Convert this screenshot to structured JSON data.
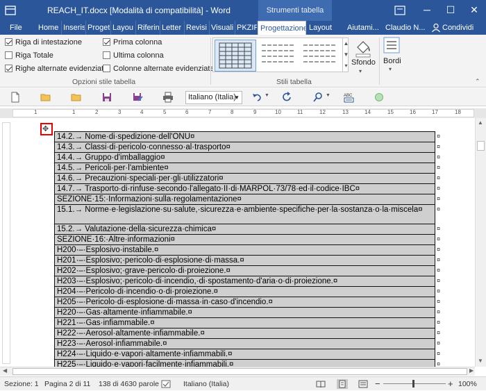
{
  "titlebar": {
    "doc_title": "REACH_IT.docx [Modalità di compatibilità]  -  Word",
    "context_tab": "Strumenti tabella",
    "minimize": "─",
    "maximize": "☐",
    "close": "✕",
    "restore_icon": "ribbon-display-icon"
  },
  "tabs": [
    {
      "label": "File"
    },
    {
      "label": "Home"
    },
    {
      "label": "Inseris"
    },
    {
      "label": "Proget"
    },
    {
      "label": "Layou"
    },
    {
      "label": "Riferin"
    },
    {
      "label": "Letter"
    },
    {
      "label": "Revisi"
    },
    {
      "label": "Visuali"
    },
    {
      "label": "PKZIP"
    },
    {
      "label": "Progettazione"
    },
    {
      "label": "Layout"
    },
    {
      "label": "Aiutami..."
    },
    {
      "label": "Claudio N..."
    },
    {
      "label": "Condividi"
    }
  ],
  "ribbon": {
    "options": [
      {
        "label": "Riga di intestazione",
        "checked": true
      },
      {
        "label": "Riga Totale",
        "checked": false
      },
      {
        "label": "Righe alternate evidenziate",
        "checked": true
      },
      {
        "label": "Prima colonna",
        "checked": true
      },
      {
        "label": "Ultima colonna",
        "checked": false
      },
      {
        "label": "Colonne alternate evidenziate",
        "checked": false
      }
    ],
    "group_options_label": "Opzioni stile tabella",
    "group_styles_label": "Stili tabella",
    "sfondo_label": "Sfondo",
    "bordi_label": "Bordi"
  },
  "toolbar": {
    "language": "Italiano (Italia)"
  },
  "ruler": {
    "numbers": [
      "1",
      "1",
      "2",
      "3",
      "4",
      "5",
      "6",
      "7",
      "8",
      "9",
      "10",
      "11",
      "12",
      "13",
      "14",
      "15",
      "16",
      "17",
      "18",
      "19"
    ]
  },
  "document": {
    "handle_glyph": "✥",
    "rows": [
      {
        "text": "14.2.→ Nome·di·spedizione·dell'ONU¤"
      },
      {
        "text": "14.3.→ Classi·di·pericolo·connesso·al·trasporto¤"
      },
      {
        "text": "14.4.→ Gruppo·d'imballaggio¤"
      },
      {
        "text": "14.5.→ Pericoli·per·l'ambiente¤"
      },
      {
        "text": "14.6.→ Precauzioni·speciali·per·gli·utilizzatori¤"
      },
      {
        "text": "14.7.→ Trasporto·di·rinfuse·secondo·l'allegato·II·di·MARPOL·73/78·ed·il·codice·IBC¤"
      },
      {
        "text": "SEZIONE·15:·Informazioni·sulla·regolamentazione¤"
      },
      {
        "text": "15.1.→ Norme·e·legislazione·su·salute,·sicurezza·e·ambiente·specifiche·per·la·sostanza·o·la·miscela¤"
      },
      {
        "text": "15.2.→ Valutazione·della·sicurezza·chimica¤"
      },
      {
        "text": "SEZIONE·16:·Altre·informazioni¤"
      },
      {
        "text": "H200·–·Esplosivo·instabile.¤"
      },
      {
        "text": "H201·–·Esplosivo;·pericolo·di·esplosione·di·massa.¤"
      },
      {
        "text": "H202·–·Esplosivo;·grave·pericolo·di·proiezione.¤"
      },
      {
        "text": "H203·–·Esplosivo;·pericolo·di·incendio,·di·spostamento·d'aria·o·di·proiezione.¤"
      },
      {
        "text": "H204·–·Pericolo·di·incendio·o·di·proiezione.¤"
      },
      {
        "text": "H205·–·Pericolo·di·esplosione·di·massa·in·caso·d'incendio.¤"
      },
      {
        "text": "H220·–·Gas·altamente·infiammabile.¤"
      },
      {
        "text": "H221·–·Gas·infiammabile.¤"
      },
      {
        "text": "H222·–·Aerosol·altamente·infiammabile.¤"
      },
      {
        "text": "H223·–·Aerosol·infiammabile.¤"
      },
      {
        "text": "H224·–·Liquido·e·vapori·altamente·infiammabili.¤"
      },
      {
        "text": "H225·–·Liquido·e·vapori·facilmente·infiammabili.¤"
      }
    ],
    "row_end_mark": "¤"
  },
  "statusbar": {
    "section": "Sezione: 1",
    "page": "Pagina 2 di 11",
    "words": "138 di 4630 parole",
    "language": "Italiano (Italia)",
    "zoom": "100%",
    "zoom_minus": "−",
    "zoom_plus": "+"
  }
}
